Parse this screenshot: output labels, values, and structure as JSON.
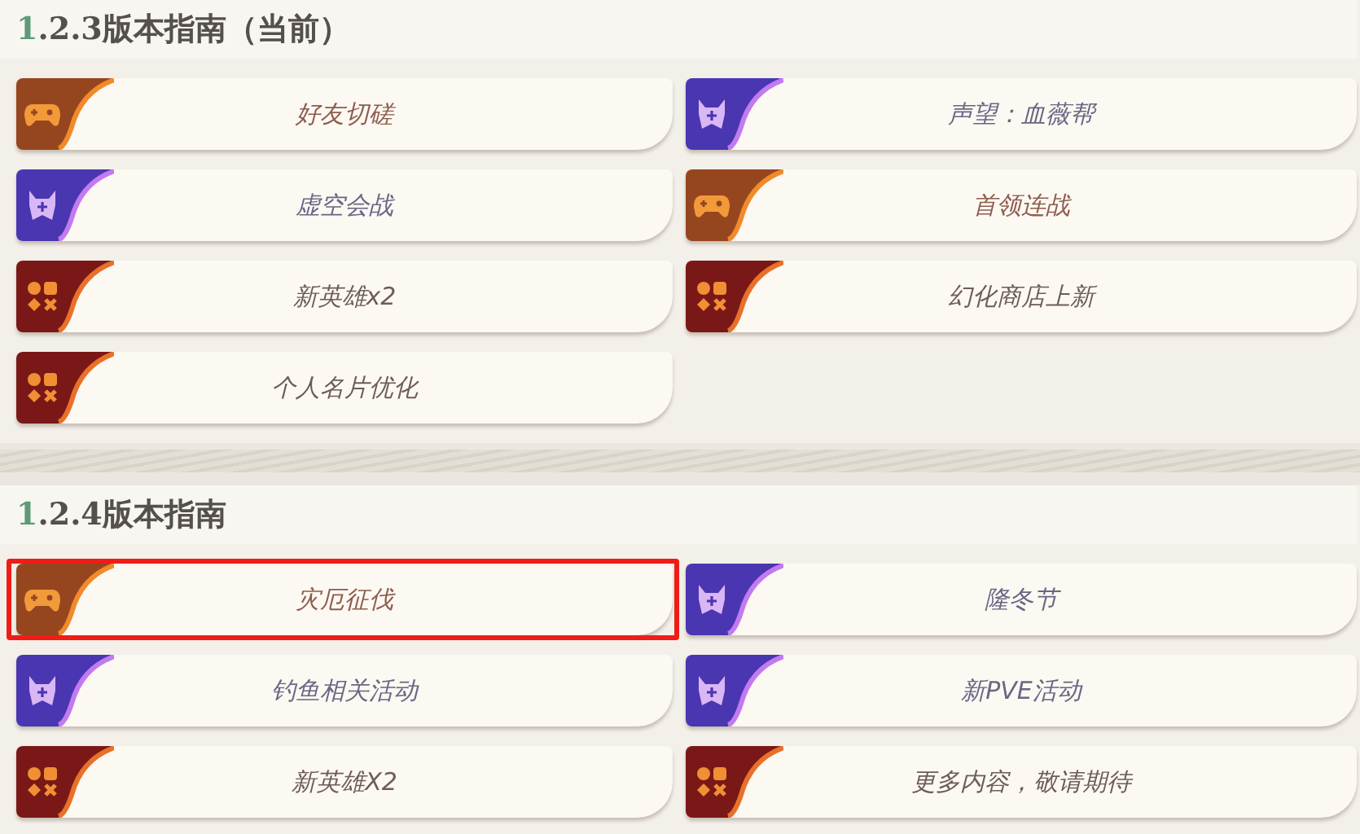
{
  "sections": [
    {
      "title": "1.2.3版本指南（当前）",
      "items": [
        {
          "label": "好友切磋",
          "kind": "game",
          "highlighted": false
        },
        {
          "label": "声望：血薇帮",
          "kind": "guild",
          "highlighted": false
        },
        {
          "label": "虚空会战",
          "kind": "guild",
          "highlighted": false
        },
        {
          "label": "首领连战",
          "kind": "game",
          "highlighted": false
        },
        {
          "label": "新英雄x2",
          "kind": "feature",
          "highlighted": false
        },
        {
          "label": "幻化商店上新",
          "kind": "feature",
          "highlighted": false
        },
        {
          "label": "个人名片优化",
          "kind": "feature",
          "highlighted": false
        }
      ]
    },
    {
      "title": "1.2.4版本指南",
      "items": [
        {
          "label": "灾厄征伐",
          "kind": "game",
          "highlighted": true
        },
        {
          "label": "隆冬节",
          "kind": "guild",
          "highlighted": false
        },
        {
          "label": "钓鱼相关活动",
          "kind": "guild",
          "highlighted": false
        },
        {
          "label": "新PVE活动",
          "kind": "guild",
          "highlighted": false
        },
        {
          "label": "新英雄X2",
          "kind": "feature",
          "highlighted": false
        },
        {
          "label": "更多内容，敬请期待",
          "kind": "feature",
          "highlighted": false
        }
      ]
    }
  ]
}
